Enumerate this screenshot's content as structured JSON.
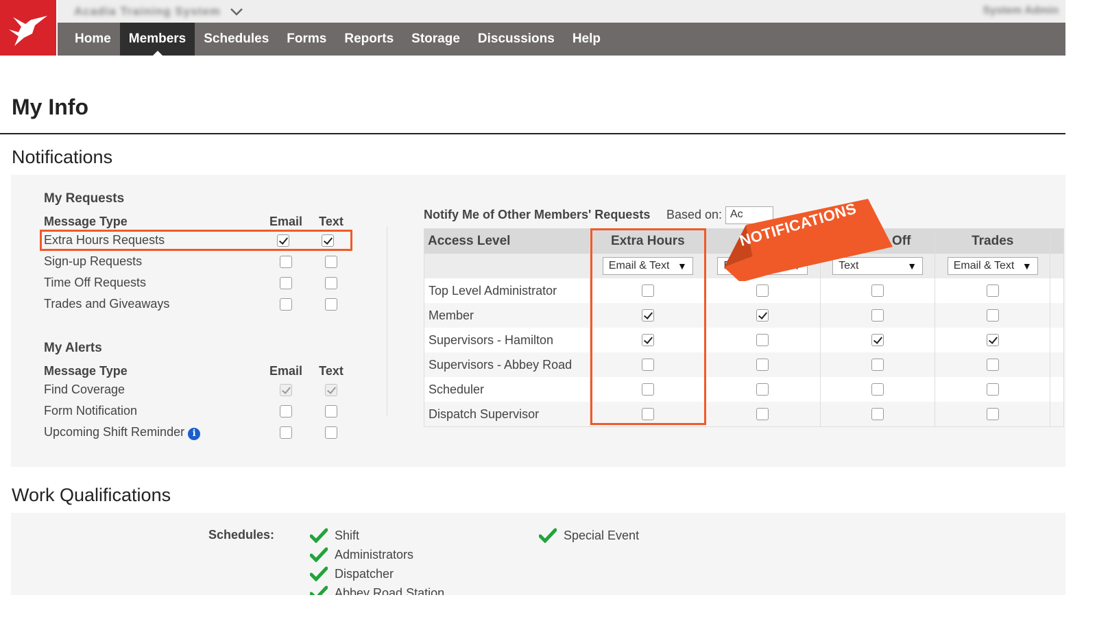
{
  "header": {
    "org_name": "Acadia Training System",
    "user_name": "System Admin",
    "nav": [
      {
        "label": "Home",
        "active": false
      },
      {
        "label": "Members",
        "active": true
      },
      {
        "label": "Schedules",
        "active": false
      },
      {
        "label": "Forms",
        "active": false
      },
      {
        "label": "Reports",
        "active": false
      },
      {
        "label": "Storage",
        "active": false
      },
      {
        "label": "Discussions",
        "active": false
      },
      {
        "label": "Help",
        "active": false
      }
    ]
  },
  "page": {
    "title": "My Info"
  },
  "notifications": {
    "section_title": "Notifications",
    "my_requests": {
      "heading": "My Requests",
      "col_type": "Message Type",
      "col_email": "Email",
      "col_text": "Text",
      "rows": [
        {
          "label": "Extra Hours Requests",
          "email": true,
          "text": true
        },
        {
          "label": "Sign-up Requests",
          "email": false,
          "text": false
        },
        {
          "label": "Time Off Requests",
          "email": false,
          "text": false
        },
        {
          "label": "Trades and Giveaways",
          "email": false,
          "text": false
        }
      ]
    },
    "my_alerts": {
      "heading": "My Alerts",
      "col_type": "Message Type",
      "col_email": "Email",
      "col_text": "Text",
      "rows": [
        {
          "label": "Find Coverage",
          "email": true,
          "text": true
        },
        {
          "label": "Form Notification",
          "email": false,
          "text": false
        },
        {
          "label": "Upcoming Shift Reminder",
          "email": false,
          "text": false
        }
      ]
    },
    "other_members": {
      "heading": "Notify Me of Other Members' Requests",
      "based_on_label": "Based on:",
      "based_on_value": "Ac",
      "banner_text": "NOTIFICATIONS",
      "col_access": "Access Level",
      "columns": [
        "Extra Hours",
        "",
        "Time Off",
        "Trades"
      ],
      "dropdowns": [
        "Email & Text",
        "E",
        "Text",
        "Email & Text"
      ],
      "rows": [
        {
          "label": "Top Level Administrator",
          "checks": [
            false,
            false,
            false,
            false
          ]
        },
        {
          "label": "Member",
          "checks": [
            true,
            true,
            false,
            false
          ]
        },
        {
          "label": "Supervisors - Hamilton",
          "checks": [
            true,
            false,
            true,
            true
          ]
        },
        {
          "label": "Supervisors - Abbey Road",
          "checks": [
            false,
            false,
            false,
            false
          ]
        },
        {
          "label": "Scheduler",
          "checks": [
            false,
            false,
            false,
            false
          ]
        },
        {
          "label": "Dispatch Supervisor",
          "checks": [
            false,
            false,
            false,
            false
          ]
        }
      ]
    }
  },
  "work_qualifications": {
    "section_title": "Work Qualifications",
    "schedules_label": "Schedules:",
    "items": [
      "Shift",
      "Administrators",
      "Dispatcher",
      "Abbey Road Station",
      "Special Event"
    ]
  },
  "colors": {
    "brand_red": "#d8232a",
    "nav_bg": "#6d6a69",
    "highlight_orange": "#f05a28",
    "check_green": "#22a33a"
  },
  "icons": [
    "hummingbird-logo-icon",
    "chevron-down-icon",
    "info-icon",
    "checkmark-icon",
    "dropdown-arrow-icon"
  ]
}
